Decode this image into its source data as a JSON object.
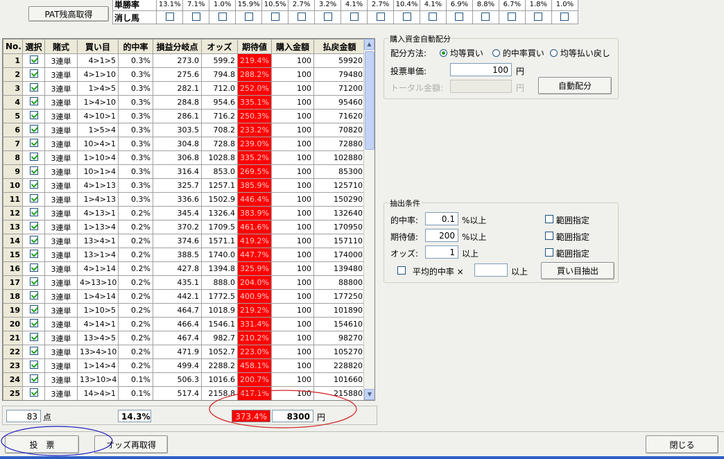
{
  "top": {
    "pat_button": "PAT残高取得",
    "win_rate_label": "単勝率",
    "scratch_label": "消し馬",
    "win_rates": [
      "13.1%",
      "7.1%",
      "1.0%",
      "15.9%",
      "10.5%",
      "2.7%",
      "3.2%",
      "4.1%",
      "2.7%",
      "10.4%",
      "4.1%",
      "6.9%",
      "8.8%",
      "6.7%",
      "1.8%",
      "1.0%"
    ]
  },
  "grid": {
    "headers": [
      "No.",
      "選択",
      "賭式",
      "買い目",
      "的中率",
      "損益分岐点",
      "オッズ",
      "期待値",
      "購入金額",
      "払戻金額"
    ],
    "rows": [
      {
        "no": "1",
        "type": "3連単",
        "bet": "4>1>5",
        "hit": "0.3%",
        "breakeven": "273.0",
        "odds": "599.2",
        "ev": "219.4%",
        "amount": "100",
        "payout": "59920"
      },
      {
        "no": "2",
        "type": "3連単",
        "bet": "4>1>10",
        "hit": "0.3%",
        "breakeven": "275.6",
        "odds": "794.8",
        "ev": "288.2%",
        "amount": "100",
        "payout": "79480"
      },
      {
        "no": "3",
        "type": "3連単",
        "bet": "1>4>5",
        "hit": "0.3%",
        "breakeven": "282.1",
        "odds": "712.0",
        "ev": "252.0%",
        "amount": "100",
        "payout": "71200"
      },
      {
        "no": "4",
        "type": "3連単",
        "bet": "1>4>10",
        "hit": "0.3%",
        "breakeven": "284.8",
        "odds": "954.6",
        "ev": "335.1%",
        "amount": "100",
        "payout": "95460"
      },
      {
        "no": "5",
        "type": "3連単",
        "bet": "4>10>1",
        "hit": "0.3%",
        "breakeven": "286.1",
        "odds": "716.2",
        "ev": "250.3%",
        "amount": "100",
        "payout": "71620"
      },
      {
        "no": "6",
        "type": "3連単",
        "bet": "1>5>4",
        "hit": "0.3%",
        "breakeven": "303.5",
        "odds": "708.2",
        "ev": "233.2%",
        "amount": "100",
        "payout": "70820"
      },
      {
        "no": "7",
        "type": "3連単",
        "bet": "10>4>1",
        "hit": "0.3%",
        "breakeven": "304.8",
        "odds": "728.8",
        "ev": "239.0%",
        "amount": "100",
        "payout": "72880"
      },
      {
        "no": "8",
        "type": "3連単",
        "bet": "1>10>4",
        "hit": "0.3%",
        "breakeven": "306.8",
        "odds": "1028.8",
        "ev": "335.2%",
        "amount": "100",
        "payout": "102880"
      },
      {
        "no": "9",
        "type": "3連単",
        "bet": "10>1>4",
        "hit": "0.3%",
        "breakeven": "316.4",
        "odds": "853.0",
        "ev": "269.5%",
        "amount": "100",
        "payout": "85300"
      },
      {
        "no": "10",
        "type": "3連単",
        "bet": "4>1>13",
        "hit": "0.3%",
        "breakeven": "325.7",
        "odds": "1257.1",
        "ev": "385.9%",
        "amount": "100",
        "payout": "125710"
      },
      {
        "no": "11",
        "type": "3連単",
        "bet": "1>4>13",
        "hit": "0.3%",
        "breakeven": "336.6",
        "odds": "1502.9",
        "ev": "446.4%",
        "amount": "100",
        "payout": "150290"
      },
      {
        "no": "12",
        "type": "3連単",
        "bet": "4>13>1",
        "hit": "0.2%",
        "breakeven": "345.4",
        "odds": "1326.4",
        "ev": "383.9%",
        "amount": "100",
        "payout": "132640"
      },
      {
        "no": "13",
        "type": "3連単",
        "bet": "1>13>4",
        "hit": "0.2%",
        "breakeven": "370.2",
        "odds": "1709.5",
        "ev": "461.6%",
        "amount": "100",
        "payout": "170950"
      },
      {
        "no": "14",
        "type": "3連単",
        "bet": "13>4>1",
        "hit": "0.2%",
        "breakeven": "374.6",
        "odds": "1571.1",
        "ev": "419.2%",
        "amount": "100",
        "payout": "157110"
      },
      {
        "no": "15",
        "type": "3連単",
        "bet": "13>1>4",
        "hit": "0.2%",
        "breakeven": "388.5",
        "odds": "1740.0",
        "ev": "447.7%",
        "amount": "100",
        "payout": "174000"
      },
      {
        "no": "16",
        "type": "3連単",
        "bet": "4>1>14",
        "hit": "0.2%",
        "breakeven": "427.8",
        "odds": "1394.8",
        "ev": "325.9%",
        "amount": "100",
        "payout": "139480"
      },
      {
        "no": "17",
        "type": "3連単",
        "bet": "4>13>10",
        "hit": "0.2%",
        "breakeven": "435.1",
        "odds": "888.0",
        "ev": "204.0%",
        "amount": "100",
        "payout": "88800"
      },
      {
        "no": "18",
        "type": "3連単",
        "bet": "1>4>14",
        "hit": "0.2%",
        "breakeven": "442.1",
        "odds": "1772.5",
        "ev": "400.9%",
        "amount": "100",
        "payout": "177250"
      },
      {
        "no": "19",
        "type": "3連単",
        "bet": "1>10>5",
        "hit": "0.2%",
        "breakeven": "464.7",
        "odds": "1018.9",
        "ev": "219.2%",
        "amount": "100",
        "payout": "101890"
      },
      {
        "no": "20",
        "type": "3連単",
        "bet": "4>14>1",
        "hit": "0.2%",
        "breakeven": "466.4",
        "odds": "1546.1",
        "ev": "331.4%",
        "amount": "100",
        "payout": "154610"
      },
      {
        "no": "21",
        "type": "3連単",
        "bet": "13>4>5",
        "hit": "0.2%",
        "breakeven": "467.4",
        "odds": "982.7",
        "ev": "210.2%",
        "amount": "100",
        "payout": "98270"
      },
      {
        "no": "22",
        "type": "3連単",
        "bet": "13>4>10",
        "hit": "0.2%",
        "breakeven": "471.9",
        "odds": "1052.7",
        "ev": "223.0%",
        "amount": "100",
        "payout": "105270"
      },
      {
        "no": "23",
        "type": "3連単",
        "bet": "1>14>4",
        "hit": "0.2%",
        "breakeven": "499.4",
        "odds": "2288.2",
        "ev": "458.1%",
        "amount": "100",
        "payout": "228820"
      },
      {
        "no": "24",
        "type": "3連単",
        "bet": "13>10>4",
        "hit": "0.1%",
        "breakeven": "506.3",
        "odds": "1016.6",
        "ev": "200.7%",
        "amount": "100",
        "payout": "101660"
      },
      {
        "no": "25",
        "type": "3連単",
        "bet": "14>4>1",
        "hit": "0.1%",
        "breakeven": "517.4",
        "odds": "2158.8",
        "ev": "417.1%",
        "amount": "100",
        "payout": "215880"
      }
    ]
  },
  "summary": {
    "points": "83",
    "points_unit": "点",
    "hit_total": "14.3%",
    "ev_total": "373.4%",
    "amount_total": "8300",
    "amount_unit": "円"
  },
  "auto_alloc": {
    "title": "購入資金自動配分",
    "method_label": "配分方法:",
    "options": [
      "均等買い",
      "的中率買い",
      "均等払い戻し"
    ],
    "unit_label": "投票単価:",
    "unit_value": "100",
    "yen": "円",
    "total_label": "トータル金額:",
    "total_value": "",
    "button": "自動配分"
  },
  "extract": {
    "title": "抽出条件",
    "hit_label": "的中率:",
    "hit_value": "0.1",
    "hit_suffix": "%以上",
    "ev_label": "期待値:",
    "ev_value": "200",
    "ev_suffix": "%以上",
    "odds_label": "オッズ:",
    "odds_value": "1",
    "odds_suffix": "以上",
    "range_label": "範囲指定",
    "avg_label": "平均的中率 ×",
    "avg_value": "",
    "avg_suffix": "以上",
    "button": "買い目抽出"
  },
  "footer": {
    "vote_button": "投　票",
    "refetch_button": "オッズ再取得",
    "close_button": "閉じる"
  },
  "colors": {
    "ev_cell": "#ff0000",
    "annotation_red": "#d02020",
    "annotation_blue": "#2020c0"
  }
}
